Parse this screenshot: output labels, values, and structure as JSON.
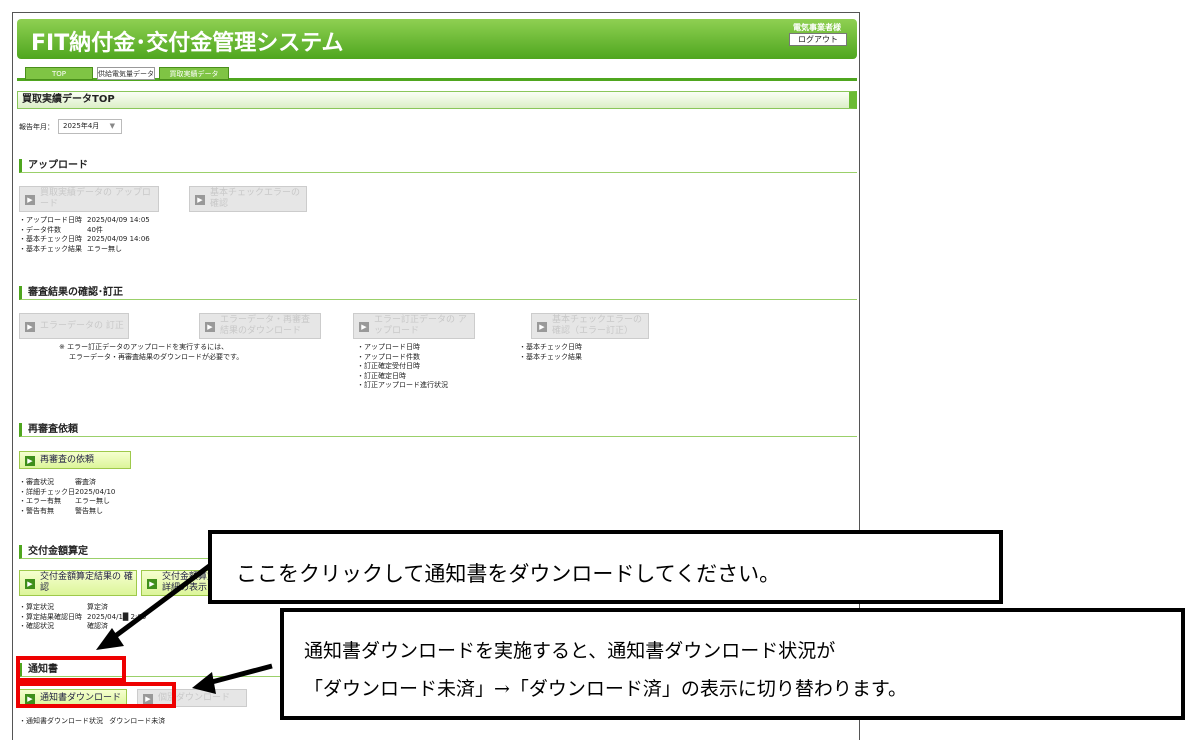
{
  "header": {
    "app_title": "FIT納付金･交付金管理システム",
    "user_label": "電気事業者様",
    "logout_label": "ログアウト"
  },
  "tabs": [
    {
      "label": "TOP"
    },
    {
      "label": "供給電気量データ"
    },
    {
      "label": "買取実績データ"
    }
  ],
  "page_title": "買取実績データTOP",
  "report_month": {
    "label": "報告年月：",
    "value": "2025年4月"
  },
  "upload": {
    "title": "アップロード",
    "buttons": [
      "買取実績データの アップロード",
      "基本チェックエラーの 確認"
    ],
    "info": [
      {
        "label": "・アップロード日時",
        "value": "2025/04/09 14:05"
      },
      {
        "label": "・データ件数",
        "value": "40件"
      },
      {
        "label": "・基本チェック日時",
        "value": "2025/04/09 14:06"
      },
      {
        "label": "・基本チェック結果",
        "value": "エラー無し"
      }
    ]
  },
  "review": {
    "title": "審査結果の確認･訂正",
    "buttons": [
      "エラーデータの 訂正",
      "エラーデータ・再審査 結果のダウンロード",
      "エラー訂正データの アップロード",
      "基本チェックエラーの 確認（エラー訂正）"
    ],
    "note": [
      "※ エラー訂正データのアップロードを実行するには、",
      "エラーデータ・再審査結果のダウンロードが必要です。"
    ],
    "info_mid": [
      "・アップロード日時",
      "・アップロード件数",
      "・訂正確定受付日時",
      "・訂正確定日時",
      "・訂正アップロード進行状況"
    ],
    "info_right": [
      "・基本チェック日時",
      "・基本チェック結果"
    ]
  },
  "rereview": {
    "title": "再審査依頼",
    "button": "再審査の依頼",
    "info": [
      {
        "label": "・審査状況",
        "value": "審査済"
      },
      {
        "label": "・詳細チェック日",
        "value": "2025/04/10"
      },
      {
        "label": "・エラー有無",
        "value": "エラー無し"
      },
      {
        "label": "・警告有無",
        "value": "警告無し"
      }
    ]
  },
  "calc": {
    "title": "交付金額算定",
    "buttons": [
      "交付金額算定結果の 確認",
      "交付金額算定 詳細の表示"
    ],
    "info": [
      {
        "label": "・算定状況",
        "value": "算定済"
      },
      {
        "label": "・算定結果確認日時",
        "value": "2025/04/1█ 2:00"
      },
      {
        "label": "・確認状況",
        "value": "確認済"
      }
    ]
  },
  "notice": {
    "title": "通知書",
    "buttons": [
      "通知書ダウンロード",
      "個別ダウンロード"
    ],
    "status_label": "・通知書ダウンロード状況",
    "status_value": "ダウンロード未済"
  },
  "callouts": {
    "first": "ここをクリックして通知書をダウンロードしてください。",
    "second_line1": "通知書ダウンロードを実施すると、通知書ダウンロード状況が",
    "second_line2": "「ダウンロード未済」→「ダウンロード済」の表示に切り替わります。"
  }
}
